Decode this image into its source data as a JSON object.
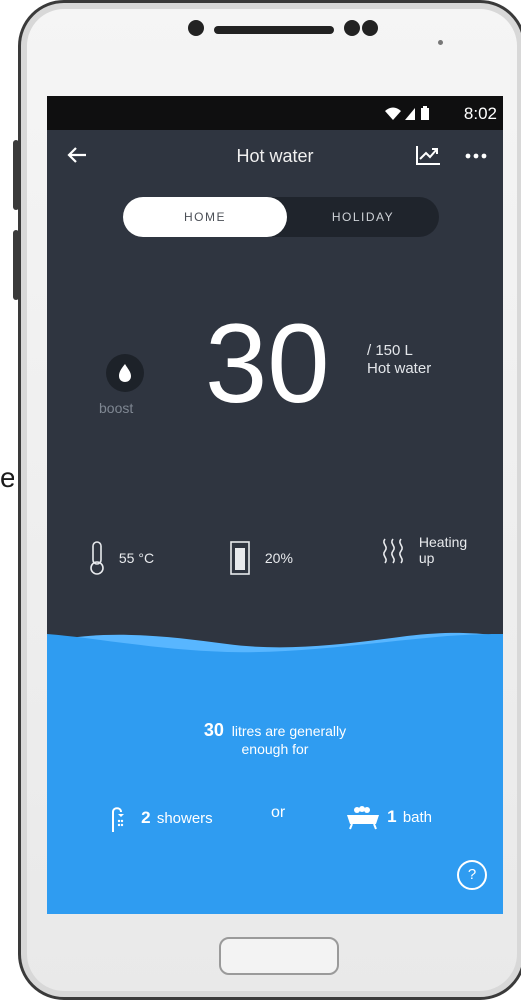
{
  "status_bar": {
    "time": "8:02"
  },
  "header": {
    "title": "Hot water",
    "back_icon": "back-arrow-icon",
    "chart_icon": "trend-chart-icon",
    "more_icon": "more-dots-icon"
  },
  "mode_toggle": {
    "options": [
      "HOME",
      "HOLIDAY"
    ],
    "selected": "HOME"
  },
  "boost": {
    "label": "boost",
    "icon": "flame-icon"
  },
  "hot_water": {
    "litres": "30",
    "capacity": "/ 150 L",
    "capacity_label": "Hot water"
  },
  "stats": {
    "temperature": "55 °C",
    "tank_level": "20%",
    "state_line1": "Heating",
    "state_line2": "up"
  },
  "usage": {
    "litres": "30",
    "text_line1": "litres are generally",
    "text_line2": "enough for",
    "showers_count": "2",
    "showers_label": "showers",
    "or": "or",
    "bath_count": "1",
    "bath_label": "bath"
  },
  "help": "?",
  "colors": {
    "screen_bg": "#2f3540",
    "water_blue": "#2f9cf1",
    "water_light": "#58b6ff",
    "text_white": "#ffffff"
  }
}
